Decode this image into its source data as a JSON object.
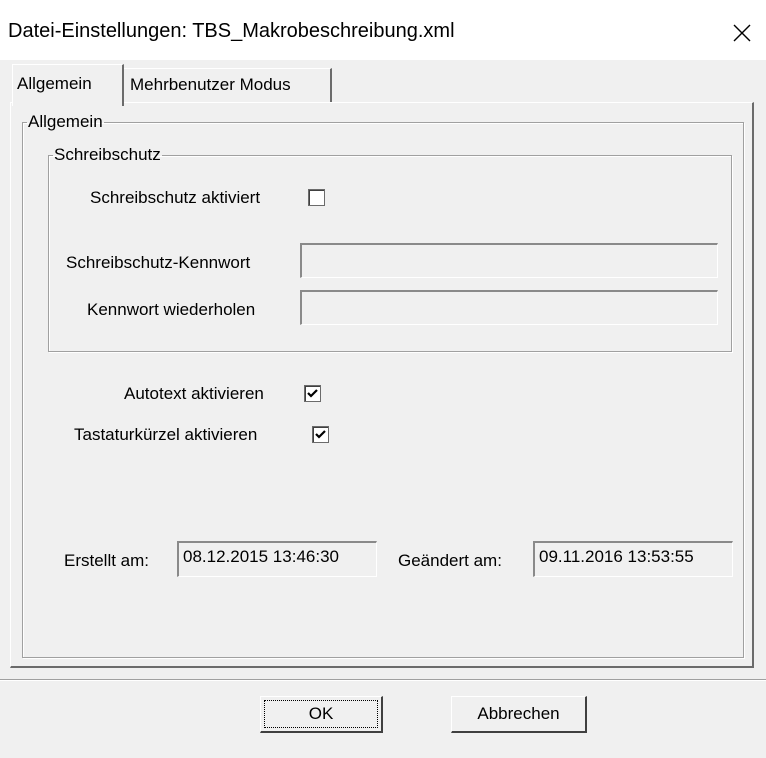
{
  "window": {
    "title": "Datei-Einstellungen: TBS_Makrobeschreibung.xml",
    "close_icon": "close-icon"
  },
  "tabs": [
    {
      "label": "Allgemein",
      "active": true
    },
    {
      "label": "Mehrbenutzer Modus",
      "active": false
    }
  ],
  "general": {
    "group_label": "Allgemein",
    "write_protection": {
      "group_label": "Schreibschutz",
      "enabled_label": "Schreibschutz aktiviert",
      "enabled": false,
      "password_label": "Schreibschutz-Kennwort",
      "password_value": "",
      "repeat_label": "Kennwort wiederholen",
      "repeat_value": ""
    },
    "autotext_label": "Autotext aktivieren",
    "autotext_checked": true,
    "shortcuts_label": "Tastaturkürzel aktivieren",
    "shortcuts_checked": true,
    "created_label": "Erstellt am:",
    "created_value": "08.12.2015 13:46:30",
    "modified_label": "Geändert am:",
    "modified_value": "09.11.2016 13:53:55"
  },
  "buttons": {
    "ok_label": "OK",
    "cancel_label": "Abbrechen"
  }
}
